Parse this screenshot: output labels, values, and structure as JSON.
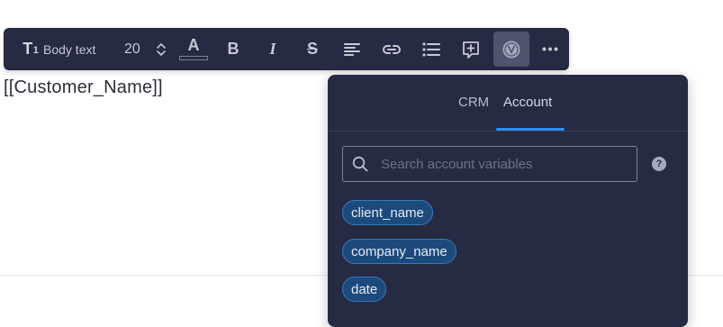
{
  "toolbar": {
    "text_style_icon": "T",
    "text_style_icon_sub": "1",
    "text_style_label": "Body text",
    "font_size": "20",
    "font_color_glyph": "A",
    "bold_glyph": "B",
    "italic_glyph": "I",
    "strike_glyph": "S",
    "icons": [
      "text-style-icon",
      "chevron-up-icon",
      "chevron-down-icon",
      "font-color-icon",
      "bold-icon",
      "italic-icon",
      "strikethrough-icon",
      "align-left-icon",
      "link-icon",
      "bullet-list-icon",
      "add-comment-icon",
      "variable-icon",
      "more-icon"
    ]
  },
  "editor": {
    "content": "[[Customer_Name]]"
  },
  "variables_popup": {
    "tabs": [
      {
        "label": "CRM",
        "active": false
      },
      {
        "label": "Account",
        "active": true
      }
    ],
    "search": {
      "placeholder": "Search account variables",
      "value": ""
    },
    "help_glyph": "?",
    "variables": [
      "client_name",
      "company_name",
      "date"
    ]
  },
  "colors": {
    "toolbar_bg": "#262a42",
    "popup_bg": "#262a42",
    "active_tab_underline": "#2d8ff0",
    "chip_bg": "#1d4a7d",
    "chip_border": "#3a79bd"
  }
}
